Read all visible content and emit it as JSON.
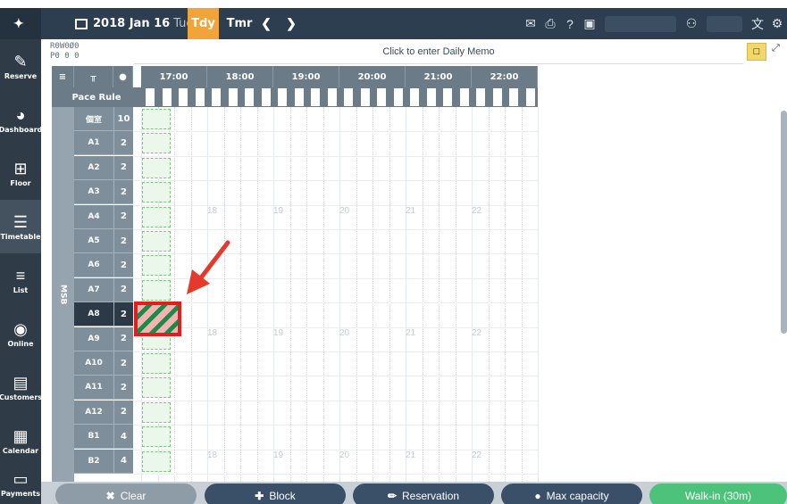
{
  "header": {
    "date": "2018 Jan 16",
    "weekday": "Tue",
    "today_label": "Tdy",
    "tomorrow_label": "Tmr",
    "prev_icon": "chevron-left-icon",
    "next_icon": "chevron-right-icon"
  },
  "counts": {
    "row1": "R0W0Ø0",
    "row2": "P0  0  0"
  },
  "memo": {
    "text": "Click to enter Daily Memo"
  },
  "sidebar": {
    "items": [
      {
        "label": "Reserve",
        "icon": "edit-icon"
      },
      {
        "label": "Dashboard",
        "icon": "dashboard-icon"
      },
      {
        "label": "Floor",
        "icon": "floor-icon"
      },
      {
        "label": "Timetable",
        "icon": "timetable-icon"
      },
      {
        "label": "List",
        "icon": "list-icon"
      },
      {
        "label": "Online",
        "icon": "globe-icon"
      },
      {
        "label": "Customers",
        "icon": "customers-icon"
      },
      {
        "label": "Calendar",
        "icon": "calendar-icon"
      },
      {
        "label": "Payments",
        "icon": "payments-icon"
      }
    ]
  },
  "timeline": {
    "hours": [
      "17:00",
      "18:00",
      "19:00",
      "20:00",
      "21:00",
      "22:00"
    ],
    "pace_rule": "Pace Rule",
    "group": "MSB",
    "grid_marks": [
      "18",
      "19",
      "20",
      "21",
      "22"
    ]
  },
  "tables": [
    {
      "name": "個室",
      "capacity": "10"
    },
    {
      "name": "A1",
      "capacity": "2"
    },
    {
      "name": "A2",
      "capacity": "2"
    },
    {
      "name": "A3",
      "capacity": "2"
    },
    {
      "name": "A4",
      "capacity": "2"
    },
    {
      "name": "A5",
      "capacity": "2"
    },
    {
      "name": "A6",
      "capacity": "2"
    },
    {
      "name": "A7",
      "capacity": "2"
    },
    {
      "name": "A8",
      "capacity": "2"
    },
    {
      "name": "A9",
      "capacity": "2"
    },
    {
      "name": "A10",
      "capacity": "2"
    },
    {
      "name": "A11",
      "capacity": "2"
    },
    {
      "name": "A12",
      "capacity": "2"
    },
    {
      "name": "B1",
      "capacity": "4"
    },
    {
      "name": "B2",
      "capacity": "4"
    }
  ],
  "actions": {
    "clear": "Clear",
    "block": "Block",
    "reservation": "Reservation",
    "max_capacity": "Max capacity",
    "walkin": "Walk-in (30m)"
  },
  "colors": {
    "accent_orange": "#f0a43a",
    "highlight_red": "#e01e1e",
    "walkin_green": "#4dc27a"
  }
}
